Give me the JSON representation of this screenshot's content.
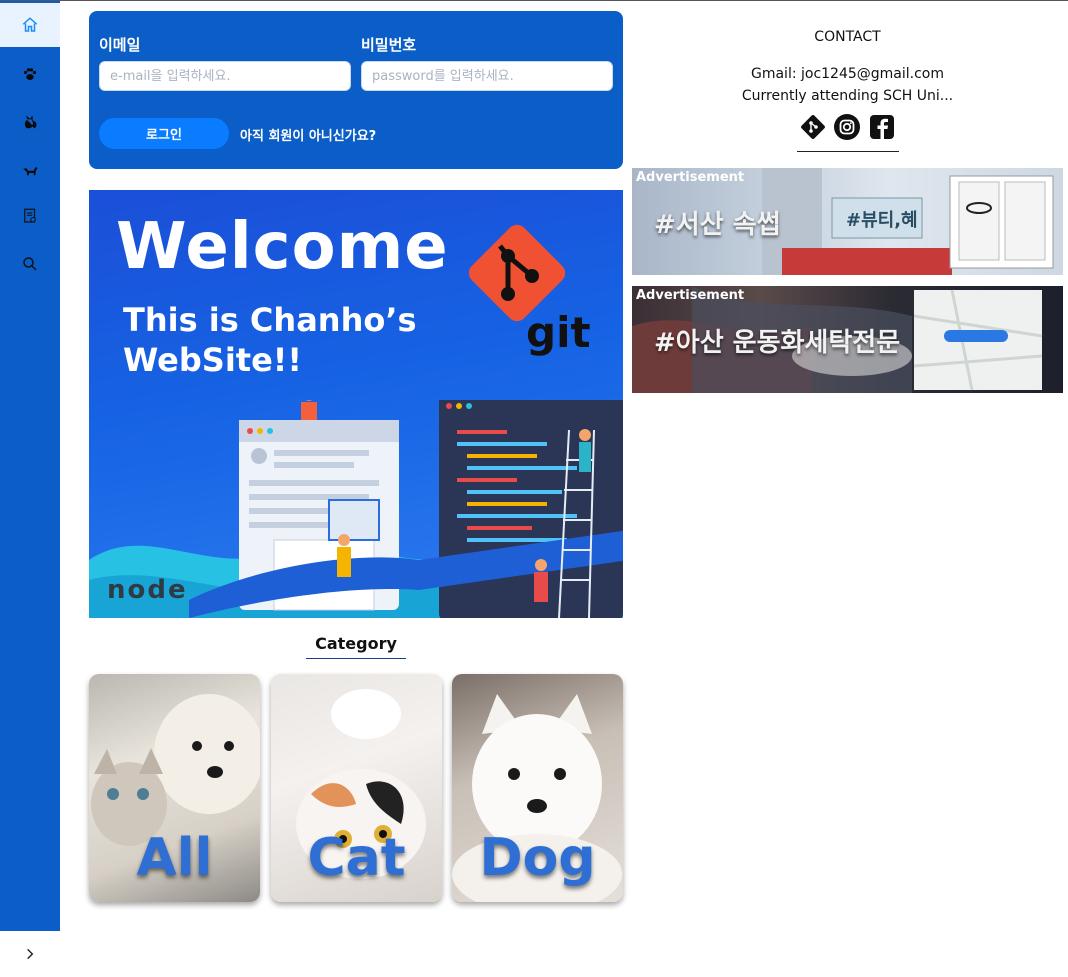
{
  "sidebar": {
    "items": [
      {
        "name": "home-icon",
        "label": "Home"
      },
      {
        "name": "paw-icon",
        "label": "Paw"
      },
      {
        "name": "cat-icon",
        "label": "Cat"
      },
      {
        "name": "dog-icon",
        "label": "Dog"
      },
      {
        "name": "board-icon",
        "label": "Board"
      },
      {
        "name": "search-icon",
        "label": "Search"
      }
    ],
    "expand_icon": "chevron-right-icon"
  },
  "login": {
    "email_label": "이메일",
    "email_placeholder": "e-mail을 입력하세요.",
    "password_label": "비밀번호",
    "password_placeholder": "password를 입력하세요.",
    "login_button": "로그인",
    "signup_link": "아직 회원이 아니신가요?"
  },
  "banner": {
    "title": "Welcome",
    "subtitle": "This is Chanho’s WebSite!!",
    "git_text": "git",
    "node_text": "node"
  },
  "category": {
    "title": "Category",
    "cards": [
      {
        "label": "All"
      },
      {
        "label": "Cat"
      },
      {
        "label": "Dog"
      }
    ]
  },
  "contact": {
    "title": "CONTACT",
    "gmail": "Gmail: joc1245@gmail.com",
    "school": "Currently attending SCH Uni...",
    "socials": [
      "git-icon",
      "instagram-icon",
      "facebook-icon"
    ]
  },
  "ads": [
    {
      "label": "Advertisement",
      "text": "#서산 속썹",
      "sign": "#뷰티,혜"
    },
    {
      "label": "Advertisement",
      "text": "#아산 운동화세탁전문"
    }
  ],
  "colors": {
    "sidebar": "#0b5ec7",
    "login_panel": "#0b5ec7",
    "login_button": "#0a7cff",
    "active_item": "#e8f3ff",
    "card_caption": "#2f6fd4"
  }
}
